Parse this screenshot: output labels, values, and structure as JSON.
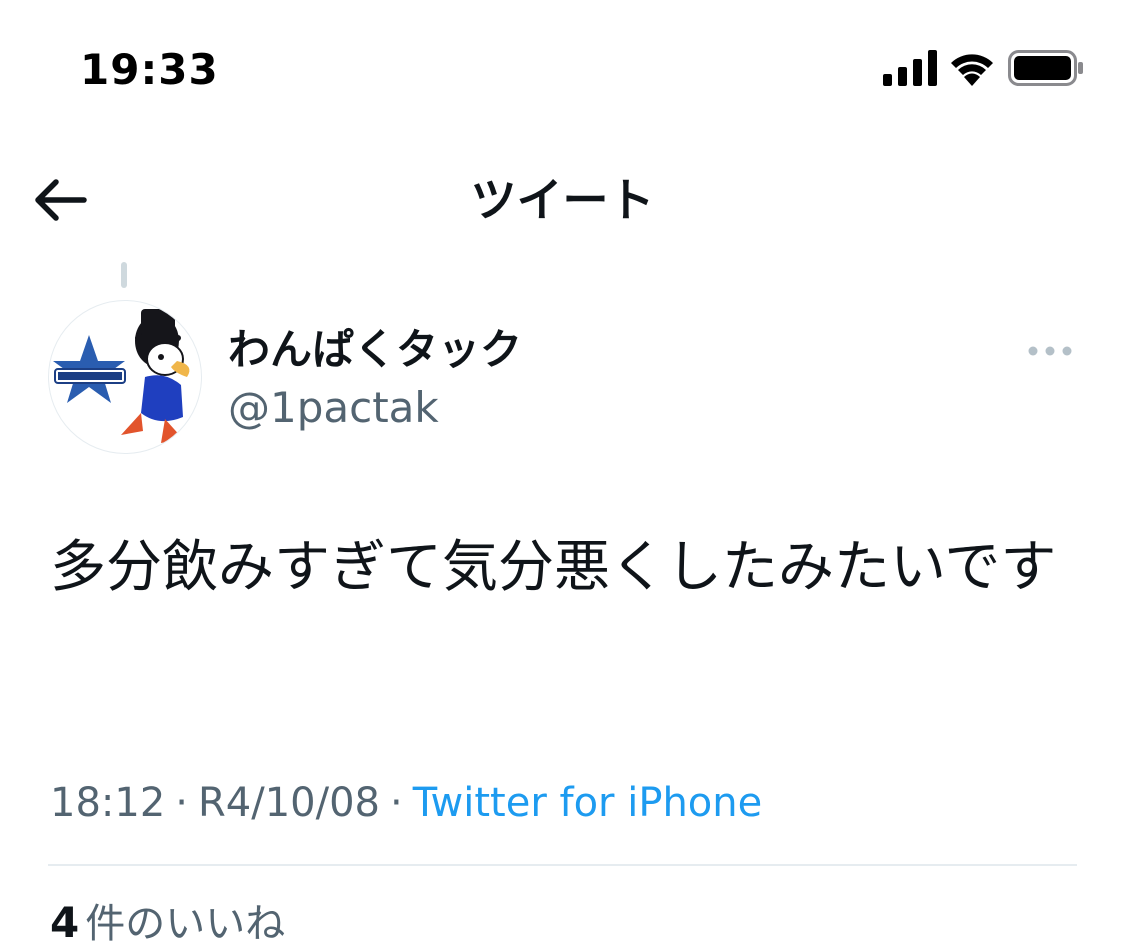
{
  "status_bar": {
    "time": "19:33",
    "icons": [
      "cellular-signal-icon",
      "wifi-icon",
      "battery-icon"
    ]
  },
  "header": {
    "title": "ツイート",
    "back_icon": "back-arrow-icon"
  },
  "tweet": {
    "author": {
      "display_name": "わんぱくタック",
      "handle": "@1pactak"
    },
    "more_icon": "more-options-icon",
    "text": "多分飲みすぎて気分悪くしたみたいです",
    "meta": {
      "time": "18:12",
      "separator": "·",
      "date": "R4/10/08",
      "source": "Twitter for iPhone"
    },
    "likes": {
      "count": "4",
      "label": "件のいいね"
    }
  },
  "colors": {
    "text_primary": "#0f1419",
    "text_secondary": "#536471",
    "link": "#1d9bf0",
    "divider": "#e6ecf0",
    "thread_line": "#cfd9de"
  }
}
